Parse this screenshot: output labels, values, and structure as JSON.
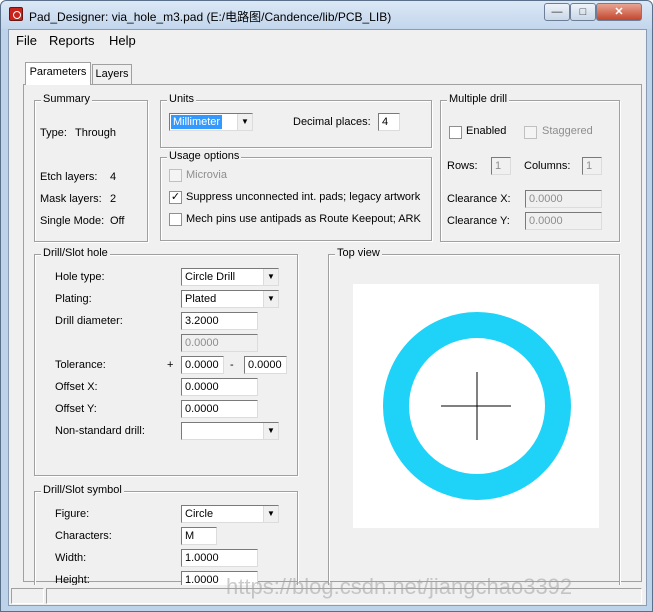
{
  "window": {
    "title": "Pad_Designer: via_hole_m3.pad (E:/电路图/Candence/lib/PCB_LIB)",
    "minimize": "—",
    "maximize": "□",
    "close": "✕"
  },
  "menu": [
    "File",
    "Reports",
    "Help"
  ],
  "tabs": [
    "Parameters",
    "Layers"
  ],
  "summary": {
    "title": "Summary",
    "type_label": "Type:",
    "type_value": "Through",
    "etch_label": "Etch layers:",
    "etch_value": "4",
    "mask_label": "Mask layers:",
    "mask_value": "2",
    "single_label": "Single Mode:",
    "single_value": "Off"
  },
  "units": {
    "title": "Units",
    "unit_value": "Millimeter",
    "decimal_label": "Decimal places:",
    "decimal_value": "4"
  },
  "usage": {
    "title": "Usage options",
    "microvia_label": "Microvia",
    "suppress_label": "Suppress unconnected int. pads; legacy artwork",
    "mech_label": "Mech pins use antipads as Route Keepout; ARK",
    "microvia_checked": false,
    "suppress_checked": true,
    "mech_checked": false
  },
  "multiple_drill": {
    "title": "Multiple drill",
    "enabled_label": "Enabled",
    "staggered_label": "Staggered",
    "rows_label": "Rows:",
    "rows_value": "1",
    "columns_label": "Columns:",
    "columns_value": "1",
    "clearance_x_label": "Clearance X:",
    "clearance_x_value": "0.0000",
    "clearance_y_label": "Clearance Y:",
    "clearance_y_value": "0.0000"
  },
  "drill_hole": {
    "title": "Drill/Slot hole",
    "hole_type_label": "Hole type:",
    "hole_type_value": "Circle Drill",
    "plating_label": "Plating:",
    "plating_value": "Plated",
    "diameter_label": "Drill diameter:",
    "diameter_value": "3.2000",
    "second_value": "0.0000",
    "tolerance_label": "Tolerance:",
    "tol_plus_sign": "+",
    "tol_plus_value": "0.0000",
    "tol_minus_sign": "-",
    "tol_minus_value": "0.0000",
    "offset_x_label": "Offset X:",
    "offset_x_value": "0.0000",
    "offset_y_label": "Offset Y:",
    "offset_y_value": "0.0000",
    "nonstd_label": "Non-standard drill:",
    "nonstd_value": ""
  },
  "drill_symbol": {
    "title": "Drill/Slot symbol",
    "figure_label": "Figure:",
    "figure_value": "Circle",
    "characters_label": "Characters:",
    "characters_value": "M",
    "width_label": "Width:",
    "width_value": "1.0000",
    "height_label": "Height:",
    "height_value": "1.0000"
  },
  "top_view": {
    "title": "Top view",
    "ring_color": "#1ed2f8"
  },
  "watermark": "https://blog.csdn.net/jiangchao3392"
}
